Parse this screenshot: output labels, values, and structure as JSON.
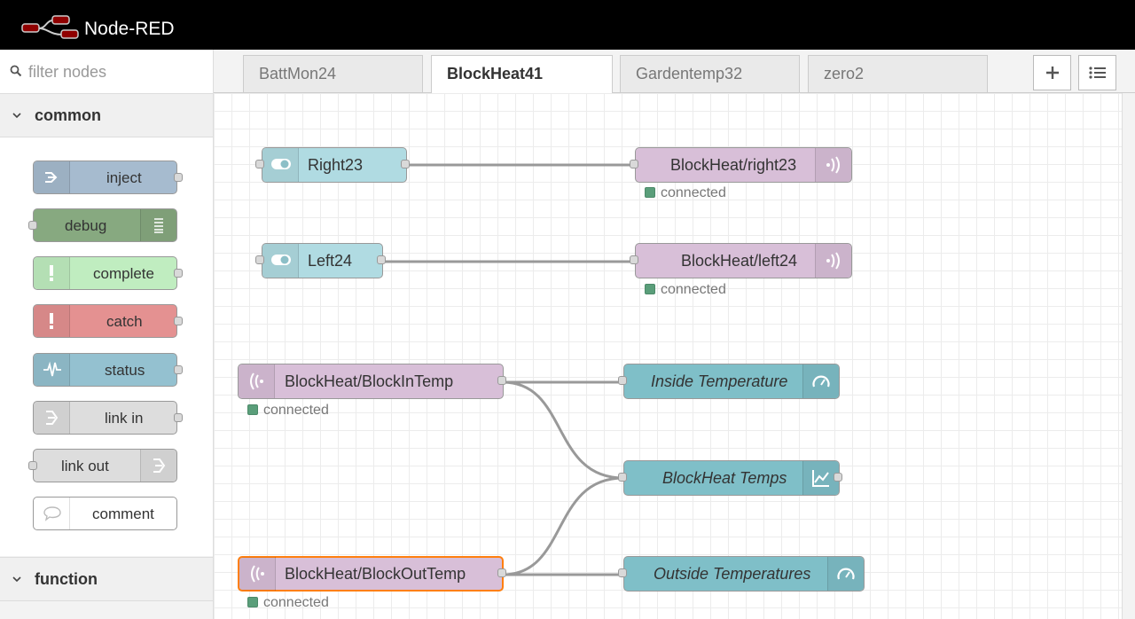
{
  "app": {
    "title": "Node-RED"
  },
  "palette": {
    "filter_placeholder": "filter nodes",
    "categories": [
      {
        "label": "common"
      },
      {
        "label": "function"
      }
    ],
    "nodes": [
      {
        "label": "inject",
        "color": "#a6bbcf"
      },
      {
        "label": "debug",
        "color": "#87a980"
      },
      {
        "label": "complete",
        "color": "#c0edc0"
      },
      {
        "label": "catch",
        "color": "#e49191"
      },
      {
        "label": "status",
        "color": "#94c1d0"
      },
      {
        "label": "link in",
        "color": "#dddddd"
      },
      {
        "label": "link out",
        "color": "#dddddd"
      },
      {
        "label": "comment",
        "color": "#ffffff"
      }
    ]
  },
  "tabs": [
    {
      "label": "BattMon24",
      "active": false
    },
    {
      "label": "BlockHeat41",
      "active": true
    },
    {
      "label": "Gardentemp32",
      "active": false
    },
    {
      "label": "zero2",
      "active": false
    }
  ],
  "flow": {
    "nodes": [
      {
        "label": "Right23",
        "type": "switch",
        "color": "#b0dbe2"
      },
      {
        "label": "BlockHeat/right23",
        "type": "mqtt out",
        "color": "#d8bfd8",
        "status": "connected"
      },
      {
        "label": "Left24",
        "type": "switch",
        "color": "#b0dbe2"
      },
      {
        "label": "BlockHeat/left24",
        "type": "mqtt out",
        "color": "#d8bfd8",
        "status": "connected"
      },
      {
        "label": "BlockHeat/BlockInTemp",
        "type": "mqtt in",
        "color": "#d8bfd8",
        "status": "connected"
      },
      {
        "label": "Inside Temperature",
        "type": "gauge",
        "color": "#7fbfc8"
      },
      {
        "label": "BlockHeat Temps",
        "type": "chart",
        "color": "#7fbfc8"
      },
      {
        "label": "BlockHeat/BlockOutTemp",
        "type": "mqtt in",
        "color": "#d8bfd8",
        "status": "connected",
        "selected": true
      },
      {
        "label": "Outside Temperatures",
        "type": "gauge",
        "color": "#7fbfc8"
      }
    ],
    "status_color": "#5a9e7a",
    "selection_color": "#ff7f0e"
  },
  "icons": {
    "logo": "node-red-logo",
    "filter": "search-icon",
    "add_tab": "plus-icon",
    "tab_list": "list-icon"
  }
}
